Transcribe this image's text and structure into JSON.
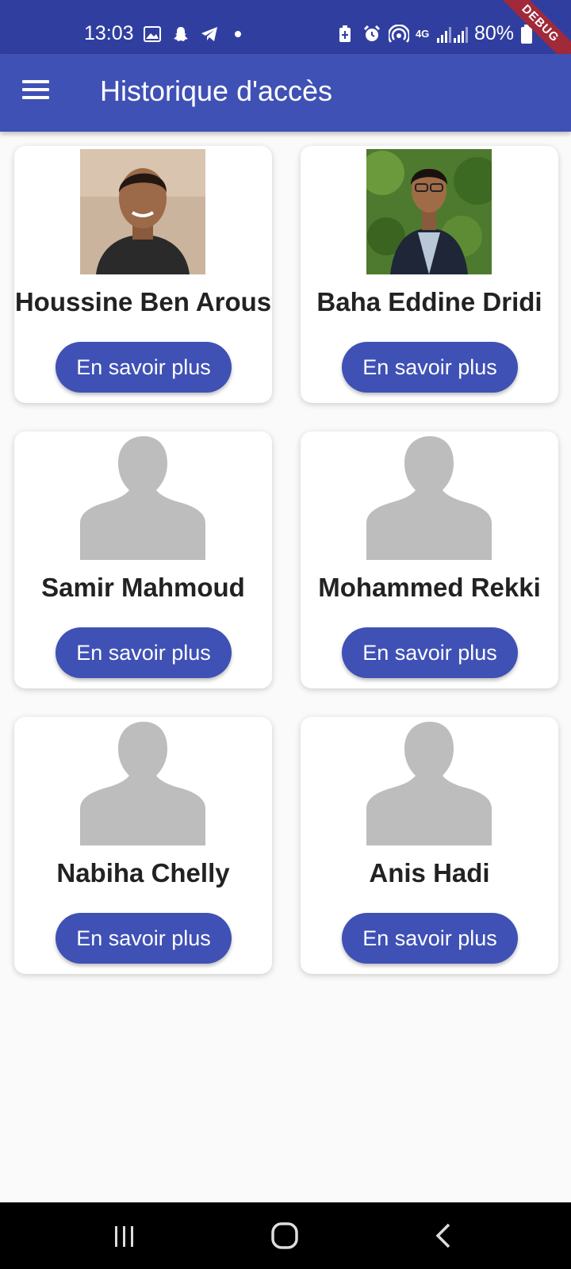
{
  "status_bar": {
    "time": "13:03",
    "network": "4G",
    "battery": "80%",
    "debug_label": "DEBUG",
    "icons": [
      "image-icon",
      "snapchat-icon",
      "telegram-icon",
      "dot-icon",
      "battery-saver-icon",
      "alarm-icon",
      "hotspot-icon",
      "signal-icon",
      "battery-icon"
    ]
  },
  "app_bar": {
    "title": "Historique d'accès",
    "menu_icon": "hamburger-menu-icon"
  },
  "people": [
    {
      "name": "Houssine Ben Arous",
      "button": "En savoir plus",
      "avatar": "photo"
    },
    {
      "name": "Baha Eddine Dridi",
      "button": "En savoir plus",
      "avatar": "photo"
    },
    {
      "name": "Samir Mahmoud",
      "button": "En savoir plus",
      "avatar": "placeholder"
    },
    {
      "name": "Mohammed Rekki",
      "button": "En savoir plus",
      "avatar": "placeholder"
    },
    {
      "name": "Nabiha Chelly",
      "button": "En savoir plus",
      "avatar": "placeholder"
    },
    {
      "name": "Anis Hadi",
      "button": "En savoir plus",
      "avatar": "placeholder"
    }
  ],
  "colors": {
    "primary": "#3f51b5",
    "status_bar": "#303f9f",
    "placeholder_avatar": "#bdbdbd"
  },
  "nav_bar": {
    "icons": [
      "recent-apps-icon",
      "home-icon",
      "back-icon"
    ]
  }
}
